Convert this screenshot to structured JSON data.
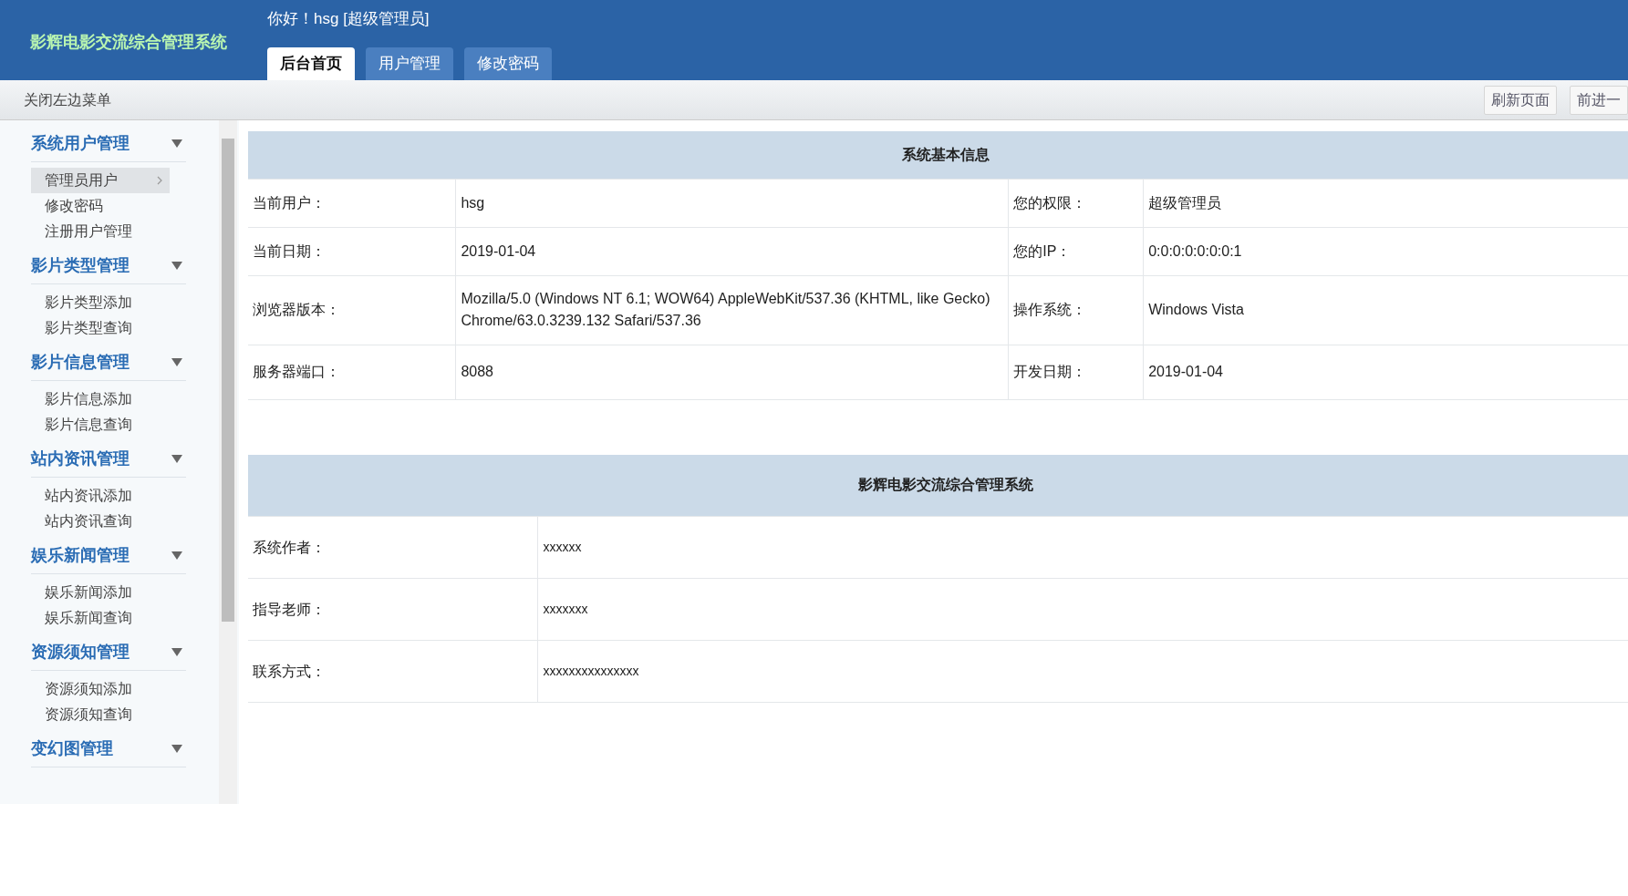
{
  "header": {
    "logo": "影辉电影交流综合管理系统",
    "greeting": "你好！hsg [超级管理员]",
    "tabs": [
      {
        "label": "后台首页",
        "selected": true
      },
      {
        "label": "用户管理",
        "selected": false
      },
      {
        "label": "修改密码",
        "selected": false
      }
    ]
  },
  "toolbar": {
    "toggle": "关闭左边菜单",
    "buttons": [
      "刷新页面",
      "前进一"
    ]
  },
  "sidebar": {
    "groups": [
      {
        "title": "系统用户管理",
        "items": [
          {
            "label": "管理员用户",
            "selected": true
          },
          {
            "label": "修改密码",
            "selected": false
          },
          {
            "label": "注册用户管理",
            "selected": false
          }
        ]
      },
      {
        "title": "影片类型管理",
        "items": [
          {
            "label": "影片类型添加",
            "selected": false
          },
          {
            "label": "影片类型查询",
            "selected": false
          }
        ]
      },
      {
        "title": "影片信息管理",
        "items": [
          {
            "label": "影片信息添加",
            "selected": false
          },
          {
            "label": "影片信息查询",
            "selected": false
          }
        ]
      },
      {
        "title": "站内资讯管理",
        "items": [
          {
            "label": "站内资讯添加",
            "selected": false
          },
          {
            "label": "站内资讯查询",
            "selected": false
          }
        ]
      },
      {
        "title": "娱乐新闻管理",
        "items": [
          {
            "label": "娱乐新闻添加",
            "selected": false
          },
          {
            "label": "娱乐新闻查询",
            "selected": false
          }
        ]
      },
      {
        "title": "资源须知管理",
        "items": [
          {
            "label": "资源须知添加",
            "selected": false
          },
          {
            "label": "资源须知查询",
            "selected": false
          }
        ]
      },
      {
        "title": "变幻图管理"
      }
    ]
  },
  "info_table": {
    "title": "系统基本信息",
    "rows": [
      [
        "当前用户：",
        "hsg",
        "您的权限：",
        "超级管理员"
      ],
      [
        "当前日期：",
        "2019-01-04",
        "您的IP：",
        "0:0:0:0:0:0:0:1"
      ],
      [
        "浏览器版本：",
        "Mozilla/5.0 (Windows NT 6.1; WOW64) AppleWebKit/537.36 (KHTML, like Gecko) Chrome/63.0.3239.132 Safari/537.36",
        "操作系统：",
        "Windows Vista"
      ],
      [
        "服务器端口：",
        "8088",
        "开发日期：",
        "2019-01-04"
      ]
    ]
  },
  "about_table": {
    "title": "影辉电影交流综合管理系统",
    "rows": [
      [
        "系统作者：",
        "xxxxxx"
      ],
      [
        "指导老师：",
        "xxxxxxx"
      ],
      [
        "联系方式：",
        "xxxxxxxxxxxxxxx"
      ]
    ]
  }
}
